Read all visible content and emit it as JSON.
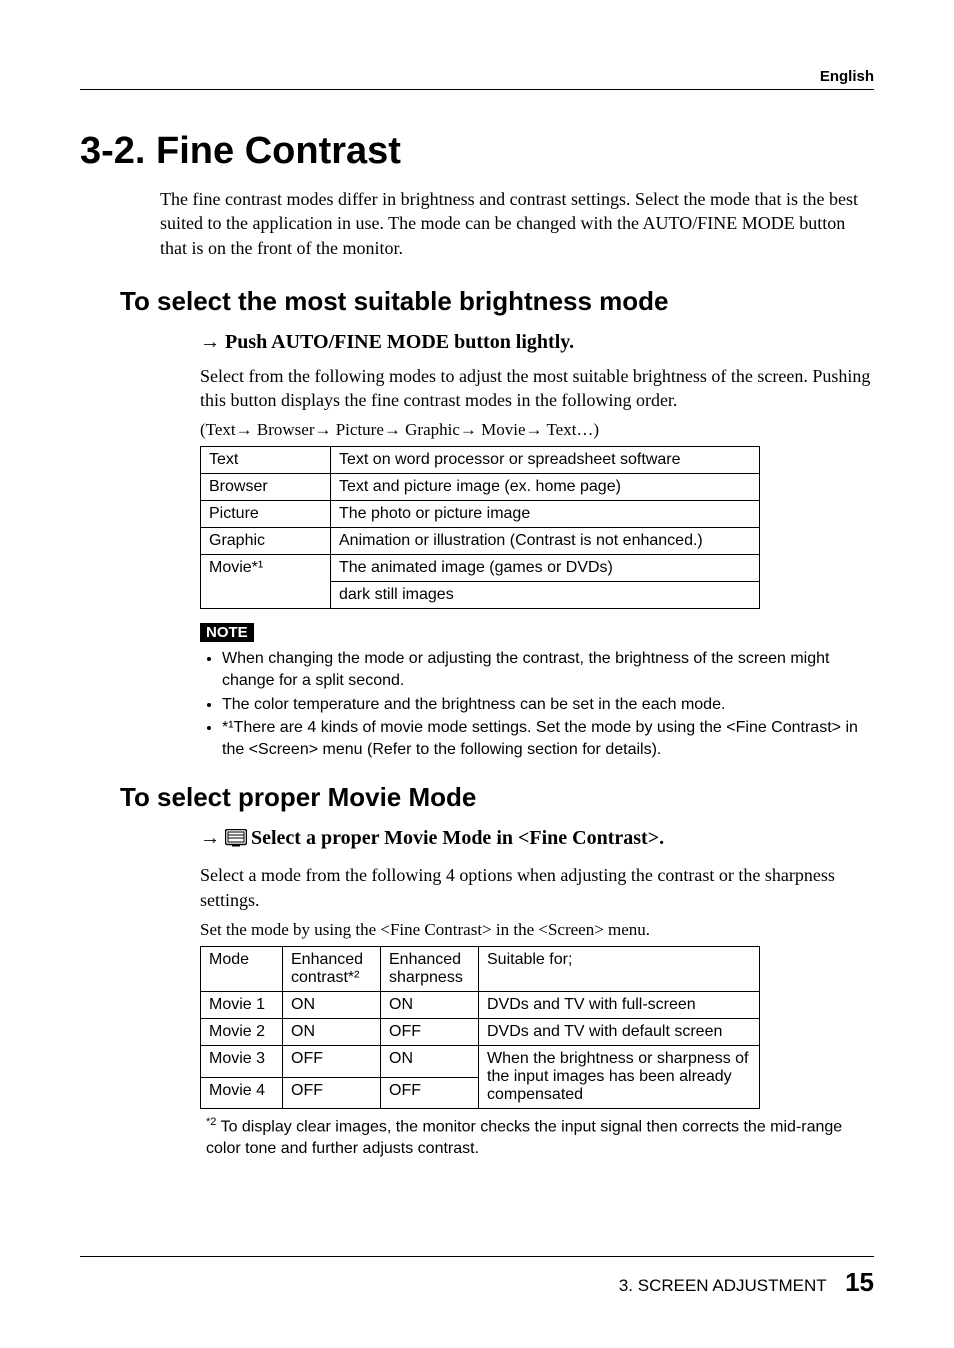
{
  "header": {
    "language": "English"
  },
  "section": {
    "number_title": "3-2. Fine Contrast",
    "intro": "The fine contrast modes differ in brightness and contrast settings. Select the mode that is the best suited to the application in use.  The mode can be changed with the AUTO/FINE MODE button that is on the front of the monitor."
  },
  "brightness": {
    "heading": "To select the most suitable brightness mode",
    "action_prefix": "→ ",
    "action": "Push AUTO/FINE MODE button lightly.",
    "para": "Select from the following modes to adjust the most suitable brightness of the screen.  Pushing this button displays the fine contrast modes in the following order.",
    "sequence": "(Text→ Browser→ Picture→ Graphic→ Movie→ Text…)",
    "rows": [
      {
        "mode": "Text",
        "desc": "Text on word processor or spreadsheet software"
      },
      {
        "mode": "Browser",
        "desc": "Text and picture image (ex. home page)"
      },
      {
        "mode": "Picture",
        "desc": "The photo or picture image"
      },
      {
        "mode": "Graphic",
        "desc": "Animation or illustration (Contrast is not enhanced.)"
      },
      {
        "mode": "Movie*¹",
        "desc": "The animated image (games or DVDs)"
      },
      {
        "mode": "",
        "desc": "dark still images"
      }
    ],
    "note_label": "NOTE",
    "notes": [
      "When changing the mode or adjusting the contrast, the brightness of the screen might change for a split second.",
      "The color temperature and the brightness can be set in the each mode.",
      "*¹There are 4 kinds of movie mode settings.  Set the mode by using the <Fine Contrast> in the <Screen> menu (Refer to the following section for details)."
    ]
  },
  "movie": {
    "heading": "To select proper Movie Mode",
    "action_prefix": "→ ",
    "action": "Select a proper Movie Mode in <Fine Contrast>.",
    "para": "Select a mode from the following 4 options when adjusting the contrast or the sharpness settings.",
    "set_line": "Set the mode by using the <Fine Contrast> in the <Screen> menu.",
    "headers": {
      "col1": "Mode",
      "col2a": "Enhanced",
      "col2b": "contrast*²",
      "col3a": "Enhanced",
      "col3b": "sharpness",
      "col4": "Suitable for;"
    },
    "rows": [
      {
        "mode": "Movie 1",
        "c": "ON",
        "s": "ON",
        "suit": "DVDs and TV with full-screen"
      },
      {
        "mode": "Movie 2",
        "c": "ON",
        "s": "OFF",
        "suit": "DVDs and TV with default screen"
      },
      {
        "mode": "Movie 3",
        "c": "OFF",
        "s": "ON",
        "suit": "When the brightness or sharpness of the input images has been already compensated"
      },
      {
        "mode": "Movie 4",
        "c": "OFF",
        "s": "OFF",
        "suit": ""
      }
    ],
    "footnote_sup": "*2",
    "footnote": " To display clear images, the monitor checks the input signal then corrects the mid-range color tone and further adjusts contrast."
  },
  "footer": {
    "chapter": "3. SCREEN ADJUSTMENT",
    "page": "15"
  }
}
